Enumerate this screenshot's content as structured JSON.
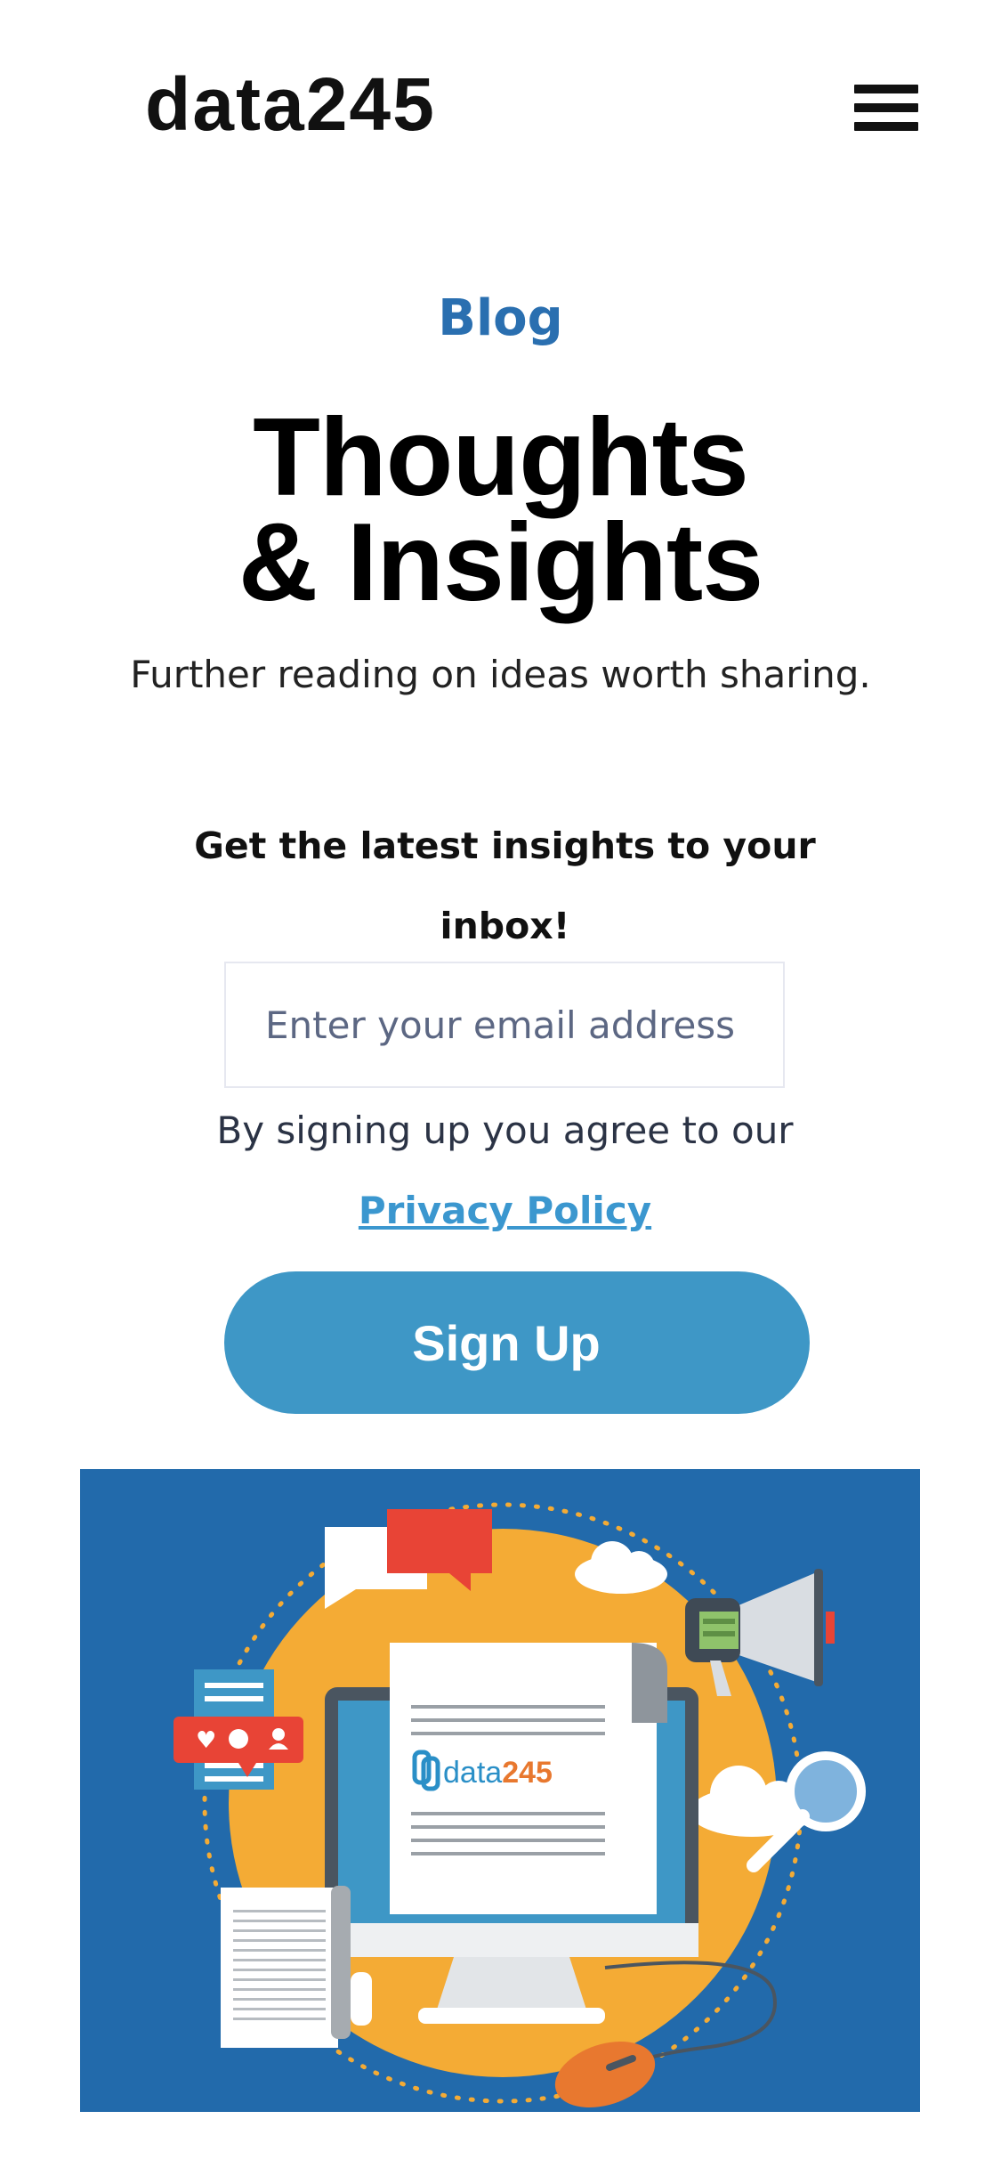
{
  "header": {
    "logo_text": "data245",
    "menu_icon": "hamburger-menu-icon"
  },
  "hero_text": {
    "eyebrow": "Blog",
    "title_line1": "Thoughts",
    "title_line2": "& Insights",
    "subtitle": "Further reading on ideas worth sharing."
  },
  "newsletter": {
    "heading": "Get the latest insights to your inbox!",
    "email_placeholder": "Enter your email address",
    "consent_prefix": "By signing up you agree to our",
    "privacy_link": "Privacy Policy",
    "signup_label": "Sign Up"
  },
  "illustration": {
    "logo_text_part1": "data",
    "logo_text_part2": "245",
    "icons": [
      "chat-bubbles-icon",
      "cloud-icon",
      "megaphone-icon",
      "social-reactions-icon",
      "computer-monitor-icon",
      "document-scroll-icon",
      "magnifier-icon",
      "mouse-icon"
    ]
  },
  "colors": {
    "accent_blue": "#2a6fb0",
    "button_blue": "#3e97c6",
    "link_blue": "#3b97cf",
    "hero_background": "#226aab",
    "hero_circle": "#f4ab35"
  }
}
